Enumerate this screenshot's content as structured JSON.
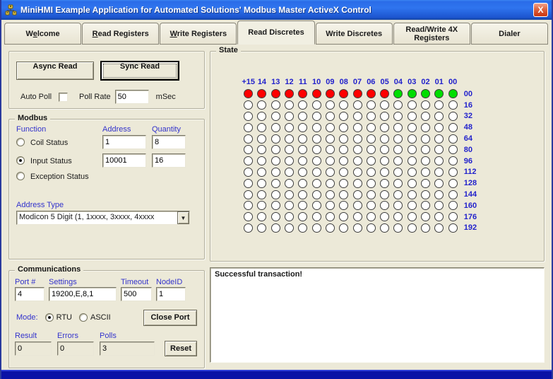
{
  "window": {
    "title": "MiniHMI Example Application for Automated Solutions' Modbus Master ActiveX Control",
    "close_glyph": "X"
  },
  "tabs": [
    {
      "label": "Welcome",
      "accel_index": 1,
      "active": false
    },
    {
      "label": "Read Registers",
      "accel_index": 0,
      "active": false
    },
    {
      "label": "Write Registers",
      "accel_index": 0,
      "active": false
    },
    {
      "label": "Read Discretes",
      "accel_index": null,
      "active": true
    },
    {
      "label": "Write Discretes",
      "accel_index": null,
      "active": false
    },
    {
      "label": "Read/Write 4X Registers",
      "accel_index": null,
      "active": false
    },
    {
      "label": "Dialer",
      "accel_index": null,
      "active": false
    }
  ],
  "read_controls": {
    "async_button": "Async Read",
    "sync_button": "Sync Read",
    "auto_poll_label": "Auto Poll",
    "auto_poll_checked": false,
    "poll_rate_label": "Poll Rate",
    "poll_rate_value": "50",
    "poll_rate_unit": "mSec"
  },
  "modbus": {
    "title": "Modbus",
    "function_label": "Function",
    "address_label": "Address",
    "quantity_label": "Quantity",
    "options": [
      {
        "label": "Coil Status",
        "selected": false,
        "address": "1",
        "quantity": "8"
      },
      {
        "label": "Input Status",
        "selected": true,
        "address": "10001",
        "quantity": "16"
      },
      {
        "label": "Exception Status",
        "selected": false,
        "address": null,
        "quantity": null
      }
    ],
    "address_type_label": "Address Type",
    "address_type_value": "Modicon 5 Digit (1, 1xxxx, 3xxxx, 4xxxx",
    "dropdown_glyph": "▼"
  },
  "communications": {
    "title": "Communications",
    "port_label": "Port #",
    "port_value": "4",
    "settings_label": "Settings",
    "settings_value": "19200,E,8,1",
    "timeout_label": "Timeout",
    "timeout_value": "500",
    "nodeid_label": "NodeID",
    "nodeid_value": "1",
    "mode_label": "Mode:",
    "mode_options": [
      {
        "label": "RTU",
        "selected": true
      },
      {
        "label": "ASCII",
        "selected": false
      }
    ],
    "close_port_button": "Close Port",
    "result_label": "Result",
    "result_value": "0",
    "errors_label": "Errors",
    "errors_value": "0",
    "polls_label": "Polls",
    "polls_value": "3",
    "reset_button": "Reset"
  },
  "state": {
    "title": "State",
    "col_headers": [
      "+15",
      "14",
      "13",
      "12",
      "11",
      "10",
      "09",
      "08",
      "07",
      "06",
      "05",
      "04",
      "03",
      "02",
      "01",
      "00"
    ],
    "row_labels": [
      "00",
      "16",
      "32",
      "48",
      "64",
      "80",
      "96",
      "112",
      "128",
      "144",
      "160",
      "176",
      "192"
    ],
    "rows": [
      "RRRRRRRRRRRGGGGG",
      "OOOOOOOOOOOOOOOO",
      "OOOOOOOOOOOOOOOO",
      "OOOOOOOOOOOOOOOO",
      "OOOOOOOOOOOOOOOO",
      "OOOOOOOOOOOOOOOO",
      "OOOOOOOOOOOOOOOO",
      "OOOOOOOOOOOOOOOO",
      "OOOOOOOOOOOOOOOO",
      "OOOOOOOOOOOOOOOO",
      "OOOOOOOOOOOOOOOO",
      "OOOOOOOOOOOOOOOO",
      "OOOOOOOOOOOOOOOO"
    ],
    "led_colors": {
      "R": "#ff0000",
      "G": "#00dd00",
      "O": "#ffffff"
    }
  },
  "log": {
    "text": "Successful transaction!"
  },
  "colors": {
    "label_blue": "#3333cc",
    "grid_label_blue": "#2222cc",
    "titlebar_blue": "#2a6ce8",
    "bottom_bar_navy": "#0a12a6",
    "window_bg": "#ece9d8"
  }
}
